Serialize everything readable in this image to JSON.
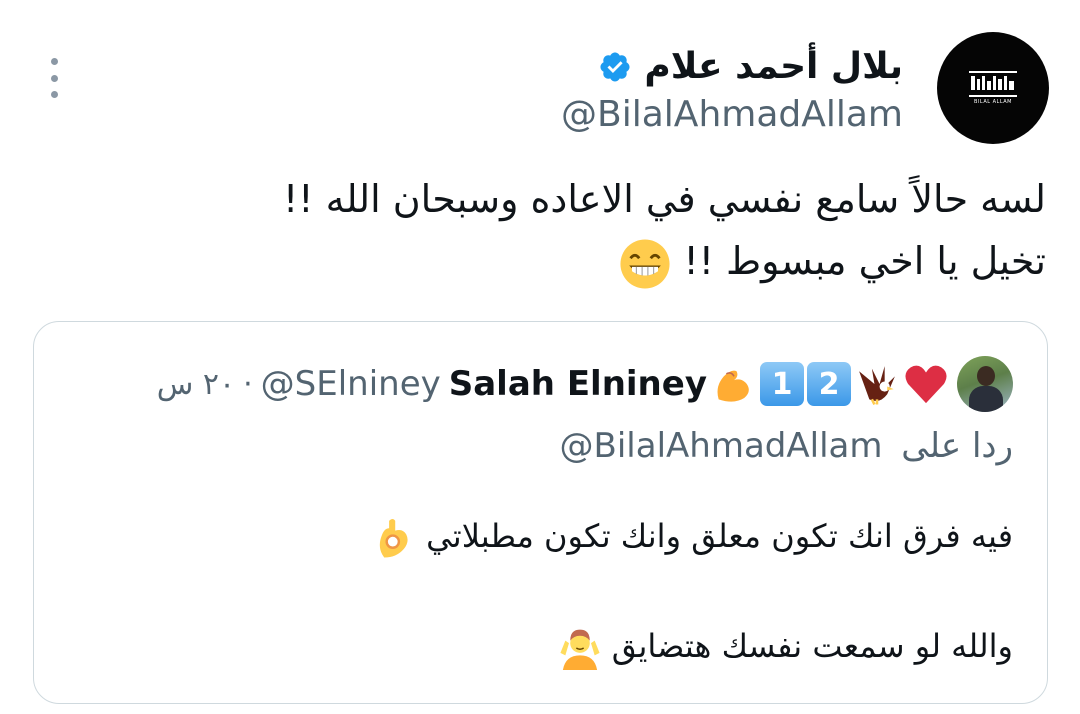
{
  "tweet": {
    "author": {
      "display_name": "بلال أحمد علام",
      "handle": "@BilalAhmadAllam",
      "avatar_logo_text": "BILAL ALLAM",
      "verified": true
    },
    "text_line1": "لسه حالاً سامع نفسي في الاعاده وسبحان الله !!",
    "text_line2": "تخيل يا اخي مبسوط !!",
    "emoji": "grinning-face-with-smiling-eyes"
  },
  "quoted_tweet": {
    "author": {
      "display_name": "Salah Elniney",
      "handle": "@SElniney",
      "name_emojis": [
        "red-heart",
        "eagle",
        "keycap-2",
        "keycap-1",
        "flexed-biceps"
      ]
    },
    "time": "٢٠ س",
    "separator": "·",
    "reply_prefix": "ردا على",
    "reply_to_handle": "@BilalAhmadAllam",
    "line1": "فيه فرق انك تكون معلق وانك تكون مطبلاتي",
    "line1_emoji": "ok-hand",
    "line2": "والله لو سمعت نفسك هتضايق",
    "line2_emoji": "person-shrugging"
  },
  "colors": {
    "text_primary": "#0f1419",
    "text_secondary": "#536471",
    "verified_blue": "#1d9bf0",
    "border": "#cfd9de"
  }
}
